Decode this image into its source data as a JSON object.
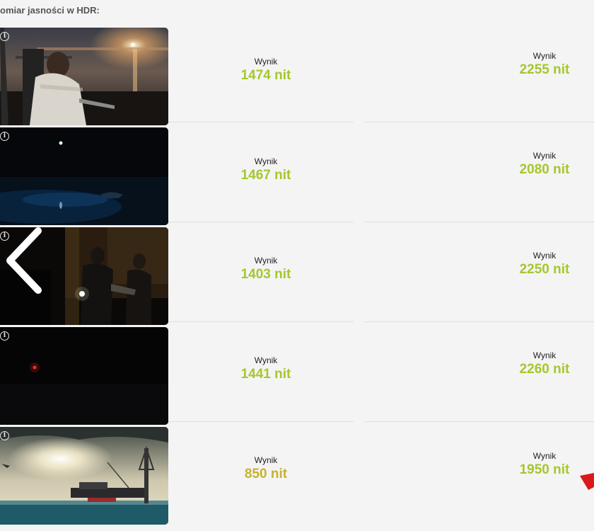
{
  "heading": "omiar jasności w HDR:",
  "info_glyph": "i",
  "colors": {
    "accent_green": "#a5c72c",
    "accent_olive": "#c6b22f",
    "marker_red": "#d9191a"
  },
  "rows": [
    {
      "left_label": "Wynik",
      "left_value": "1474 nit",
      "right_label": "Wynik",
      "right_value": "2255 nit"
    },
    {
      "left_label": "Wynik",
      "left_value": "1467 nit",
      "right_label": "Wynik",
      "right_value": "2080 nit"
    },
    {
      "left_label": "Wynik",
      "left_value": "1403 nit",
      "right_label": "Wynik",
      "right_value": "2250 nit"
    },
    {
      "left_label": "Wynik",
      "left_value": "1441 nit",
      "right_label": "Wynik",
      "right_value": "2260 nit"
    },
    {
      "left_label": "Wynik",
      "left_value": "850 nit",
      "right_label": "Wynik",
      "right_value": "1950 nit"
    }
  ],
  "icons": {
    "prev": "chevron-left-icon",
    "marker": "red-arrow-icon",
    "info": "info-icon"
  }
}
